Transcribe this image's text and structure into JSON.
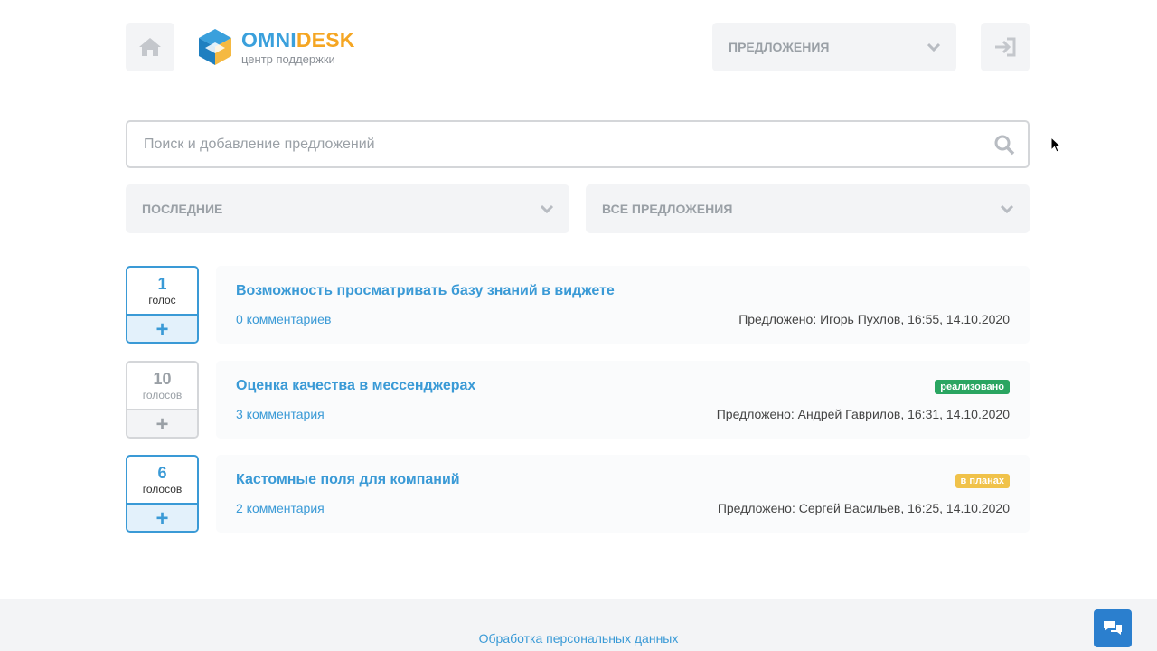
{
  "header": {
    "logo_brand_part1": "OMNI",
    "logo_brand_part2": "DESK",
    "logo_subtitle": "центр поддержки",
    "section_select": "ПРЕДЛОЖЕНИЯ",
    "home_icon": "home-icon",
    "login_icon": "sign-in-icon"
  },
  "search": {
    "placeholder": "Поиск и добавление предложений",
    "value": ""
  },
  "filters": {
    "sort": "ПОСЛЕДНИЕ",
    "status": "ВСЕ ПРЕДЛОЖЕНИЯ"
  },
  "items": [
    {
      "votes": "1",
      "votes_label": "голос",
      "voted": true,
      "title": "Возможность просматривать базу знаний в виджете",
      "comments": "0 комментариев",
      "meta": "Предложено: Игорь Пухлов, 16:55, 14.10.2020",
      "badge": "",
      "badge_color": ""
    },
    {
      "votes": "10",
      "votes_label": "голосов",
      "voted": false,
      "title": "Оценка качества в мессенджерах",
      "comments": "3 комментария",
      "meta": "Предложено: Андрей Гаврилов, 16:31, 14.10.2020",
      "badge": "реализовано",
      "badge_color": "#2aa561"
    },
    {
      "votes": "6",
      "votes_label": "голосов",
      "voted": true,
      "title": "Кастомные поля для компаний",
      "comments": "2 комментария",
      "meta": "Предложено: Сергей Васильев, 16:25, 14.10.2020",
      "badge": "в планах",
      "badge_color": "#f0c24a"
    }
  ],
  "vote_plus": "+",
  "footer": {
    "link": "Обработка персональных данных"
  },
  "colors": {
    "accent": "#3a9ad6",
    "brand_blue": "#3aa0dc",
    "brand_orange": "#f5a623",
    "chat_button": "#2b7fce"
  }
}
